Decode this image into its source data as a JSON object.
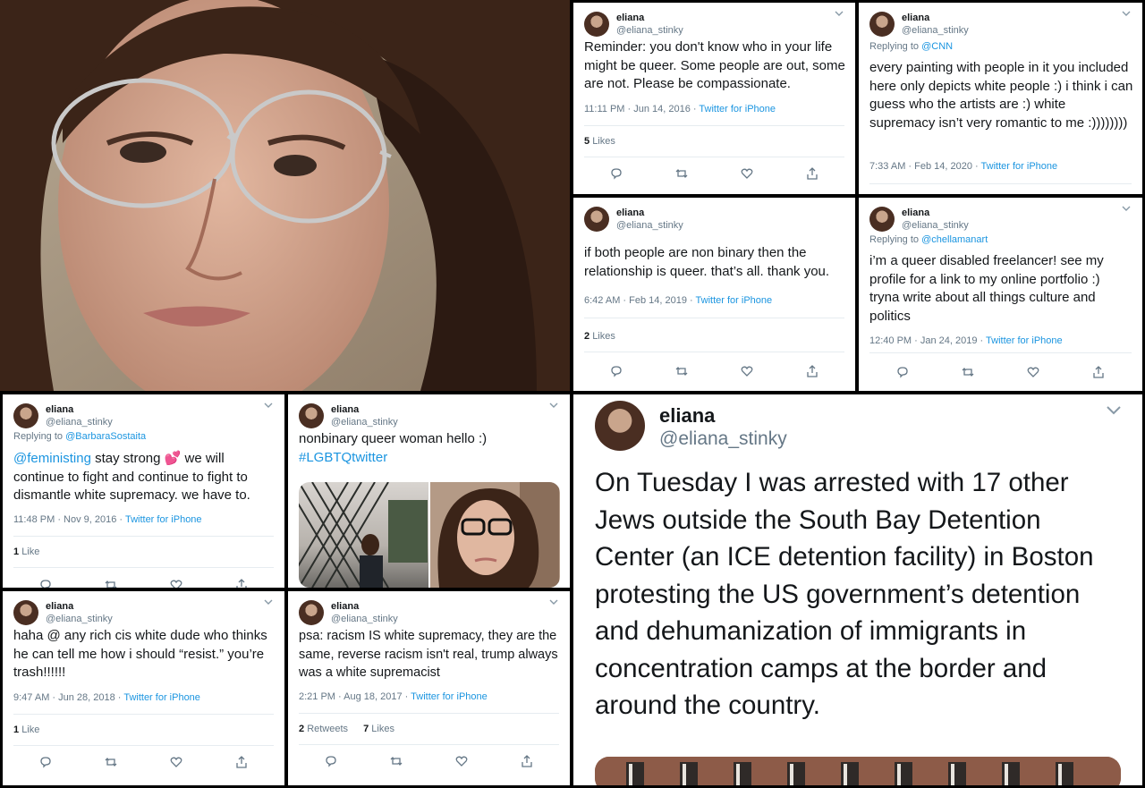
{
  "user": {
    "display_name": "eliana",
    "handle": "@eliana_stinky"
  },
  "tweets": {
    "t1": {
      "text": "Reminder: you don't know who in your life might be queer. Some people are out, some are not. Please be compassionate.",
      "time": "11:11 PM · Jun 14, 2016",
      "source": "Twitter for iPhone",
      "likes_count": "5",
      "likes_label": "Likes"
    },
    "t2": {
      "replying_prefix": "Replying to",
      "replying_to": "@CNN",
      "text": "every painting with people in it you included here only depicts white people :) i think i can guess who the artists are :) white supremacy isn’t very romantic to me :))))))))",
      "time": "7:33 AM · Feb 14, 2020",
      "source": "Twitter for iPhone"
    },
    "t3": {
      "text": "if both people are non binary then the relationship is queer. that’s all. thank you.",
      "time": "6:42 AM · Feb 14, 2019",
      "source": "Twitter for iPhone",
      "likes_count": "2",
      "likes_label": "Likes"
    },
    "t4": {
      "replying_prefix": "Replying to",
      "replying_to": "@chellamanart",
      "text": "i’m a queer disabled freelancer! see my profile for a link to my online portfolio :) tryna write about all things culture and politics",
      "time": "12:40 PM · Jan 24, 2019",
      "source": "Twitter for iPhone"
    },
    "t5": {
      "replying_prefix": "Replying to",
      "replying_to": "@BarbaraSostaita",
      "mention": "@feministing",
      "text_a": " stay strong ",
      "emoji": "💕",
      "text_b": " we will continue to fight and continue to fight to dismantle white supremacy. we have to.",
      "time": "11:48 PM · Nov 9, 2016",
      "source": "Twitter for iPhone",
      "likes_count": "1",
      "likes_label": "Like"
    },
    "t6": {
      "text": "nonbinary queer woman hello :)",
      "hashtag": "#LGBTQtwitter"
    },
    "t7": {
      "text": "haha @ any rich cis white dude who thinks he can tell me how i should “resist.” you’re trash!!!!!!",
      "time": "9:47 AM · Jun 28, 2018",
      "source": "Twitter for iPhone",
      "likes_count": "1",
      "likes_label": "Like"
    },
    "t8": {
      "text": "psa: racism IS white supremacy, they are the same, reverse racism isn't real, trump always was a white supremacist",
      "time": "2:21 PM · Aug 18, 2017",
      "source": "Twitter for iPhone",
      "retweets_count": "2",
      "retweets_label": "Retweets",
      "likes_count": "7",
      "likes_label": "Likes"
    },
    "big": {
      "text": "On Tuesday I was arrested with 17 other Jews outside the South Bay Detention Center (an ICE detention facility) in Boston protesting the US government’s detention and dehumanization of immigrants in concentration camps at the border and around the country."
    }
  },
  "icons": [
    "reply-icon",
    "retweet-icon",
    "like-icon",
    "share-icon",
    "chevron-down-icon"
  ],
  "colors": {
    "link": "#1b95e0",
    "muted": "#657786",
    "text": "#14171a",
    "border": "#e6ecf0"
  }
}
